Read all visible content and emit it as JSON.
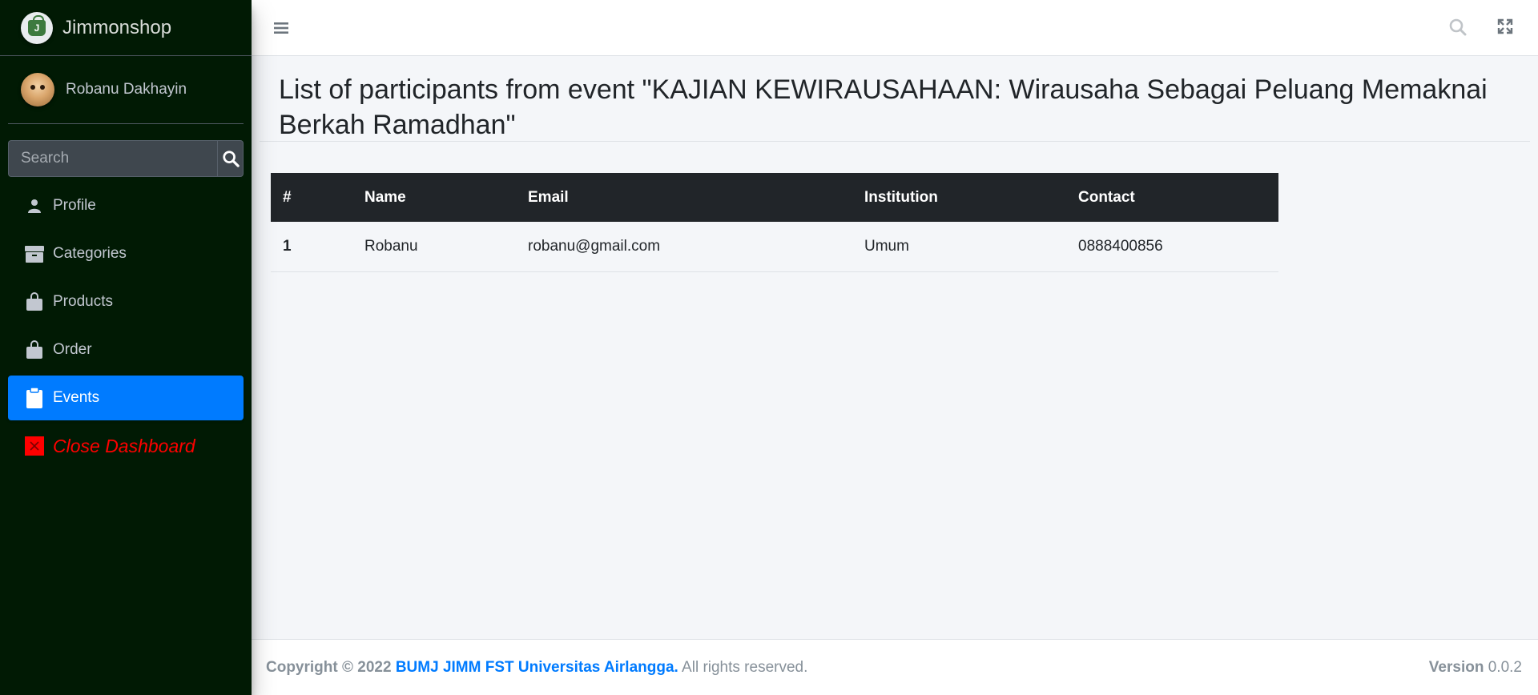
{
  "brand": {
    "name": "Jimmonshop",
    "logo_text": "J"
  },
  "user": {
    "name": "Robanu Dakhayin"
  },
  "search": {
    "placeholder": "Search"
  },
  "sidebar": {
    "items": [
      {
        "label": "Profile",
        "icon": "person-icon"
      },
      {
        "label": "Categories",
        "icon": "box-icon"
      },
      {
        "label": "Products",
        "icon": "shopping-bag-icon"
      },
      {
        "label": "Order",
        "icon": "shopping-bag-icon"
      },
      {
        "label": "Events",
        "icon": "clipboard-icon",
        "active": true
      },
      {
        "label": "Close Dashboard",
        "icon": "close-square-icon"
      }
    ]
  },
  "page": {
    "title": "List of participants from event \"KAJIAN KEWIRAUSAHAAN: Wirausaha Sebagai Peluang Memaknai Berkah Ramadhan\""
  },
  "table": {
    "headers": [
      "#",
      "Name",
      "Email",
      "Institution",
      "Contact"
    ],
    "rows": [
      [
        "1",
        "Robanu",
        "robanu@gmail.com",
        "Umum",
        "0888400856"
      ]
    ]
  },
  "footer": {
    "copyright_prefix": "Copyright © 2022",
    "org_link": "BUMJ JIMM FST Universitas Airlangga.",
    "rights": "All rights reserved.",
    "version_label": "Version",
    "version_value": "0.0.2"
  },
  "colors": {
    "sidebar_bg": "#011a04",
    "active": "#007bff",
    "close": "#ff0000",
    "table_head": "#212529"
  }
}
